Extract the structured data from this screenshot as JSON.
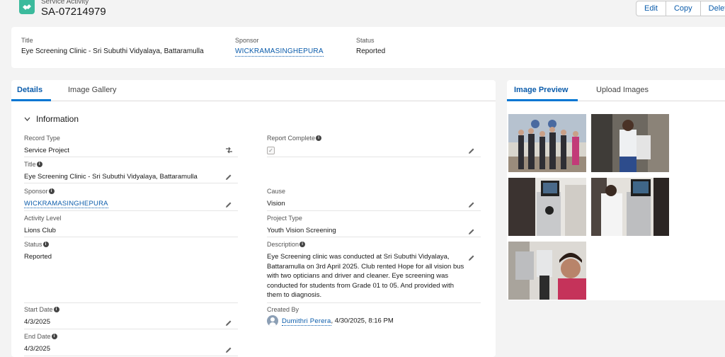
{
  "header": {
    "object_type": "Service Activity",
    "record_name": "SA-07214979",
    "icon": "handshake-icon",
    "buttons": {
      "edit": "Edit",
      "copy": "Copy",
      "delete": "Delete"
    }
  },
  "highlights": {
    "title_label": "Title",
    "title_value": "Eye Screening Clinic - Sri Subuthi Vidyalaya, Battaramulla",
    "sponsor_label": "Sponsor",
    "sponsor_value": "WICKRAMASINGHEPURA",
    "status_label": "Status",
    "status_value": "Reported"
  },
  "detail_tabs": {
    "details": "Details",
    "gallery": "Image Gallery"
  },
  "section": {
    "title": "Information"
  },
  "fields": {
    "record_type": {
      "label": "Record Type",
      "value": "Service Project"
    },
    "report_complete": {
      "label": "Report Complete",
      "checked": true
    },
    "title": {
      "label": "Title",
      "value": "Eye Screening Clinic - Sri Subuthi Vidyalaya, Battaramulla"
    },
    "sponsor": {
      "label": "Sponsor",
      "value": "WICKRAMASINGHEPURA"
    },
    "cause": {
      "label": "Cause",
      "value": "Vision"
    },
    "activity_level": {
      "label": "Activity Level",
      "value": "Lions Club"
    },
    "project_type": {
      "label": "Project Type",
      "value": "Youth Vision Screening"
    },
    "status": {
      "label": "Status",
      "value": "Reported"
    },
    "description": {
      "label": "Description",
      "value": "Eye Screening clinic was conducted at Sri Subuthi Vidyalaya, Battaramulla on 3rd April 2025. Club rented Hope for all vision bus with two opticians and driver and cleaner. Eye screening was conducted for students from Grade 01 to 05. And provided with them to diagnosis."
    },
    "start_date": {
      "label": "Start Date",
      "value": "4/3/2025"
    },
    "created_by": {
      "label": "Created By",
      "user": "Dumithri Perera",
      "timestamp": ", 4/30/2025, 8:16 PM"
    },
    "end_date": {
      "label": "End Date",
      "value": "4/3/2025"
    }
  },
  "image_tabs": {
    "preview": "Image Preview",
    "upload": "Upload Images"
  },
  "images": [
    {
      "name": "group-photo-thumbnail"
    },
    {
      "name": "student-at-bus-thumbnail"
    },
    {
      "name": "eye-exam-1-thumbnail"
    },
    {
      "name": "eye-exam-2-thumbnail"
    },
    {
      "name": "selfie-thumbnail"
    }
  ],
  "colors": {
    "brand": "#0176d3",
    "link": "#0b5cab",
    "icon_bg": "#3bba9c"
  }
}
